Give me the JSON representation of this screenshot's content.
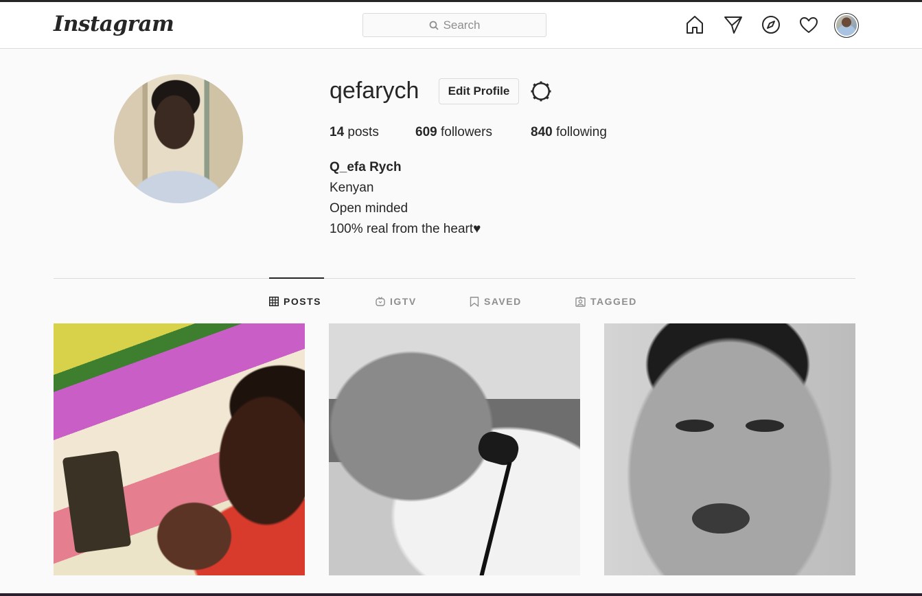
{
  "nav": {
    "logo": "Instagram",
    "search_placeholder": "Search",
    "icons": [
      "home-icon",
      "direct-icon",
      "explore-icon",
      "activity-heart-icon",
      "profile-avatar"
    ]
  },
  "profile": {
    "username": "qefarych",
    "edit_label": "Edit Profile",
    "settings_icon": "gear-icon",
    "stats": {
      "posts_count": "14",
      "posts_label": "posts",
      "followers_count": "609",
      "followers_label": "followers",
      "following_count": "840",
      "following_label": "following"
    },
    "full_name": "Q_efa Rych",
    "bio_lines": [
      "Kenyan",
      "Open minded",
      "100% real from the heart♥"
    ]
  },
  "tabs": [
    {
      "label": "POSTS",
      "icon": "grid-icon",
      "active": true
    },
    {
      "label": "IGTV",
      "icon": "igtv-icon",
      "active": false
    },
    {
      "label": "SAVED",
      "icon": "bookmark-icon",
      "active": false
    },
    {
      "label": "TAGGED",
      "icon": "tagged-icon",
      "active": false
    }
  ],
  "posts": [
    {
      "subject": "colorful-portrait-photo"
    },
    {
      "subject": "cat-with-earphones-photo"
    },
    {
      "subject": "bw-portrait-photo"
    }
  ],
  "colors": {
    "background": "#fafafa",
    "text": "#262626",
    "muted": "#8e8e8e",
    "border": "#dbdbdb"
  }
}
